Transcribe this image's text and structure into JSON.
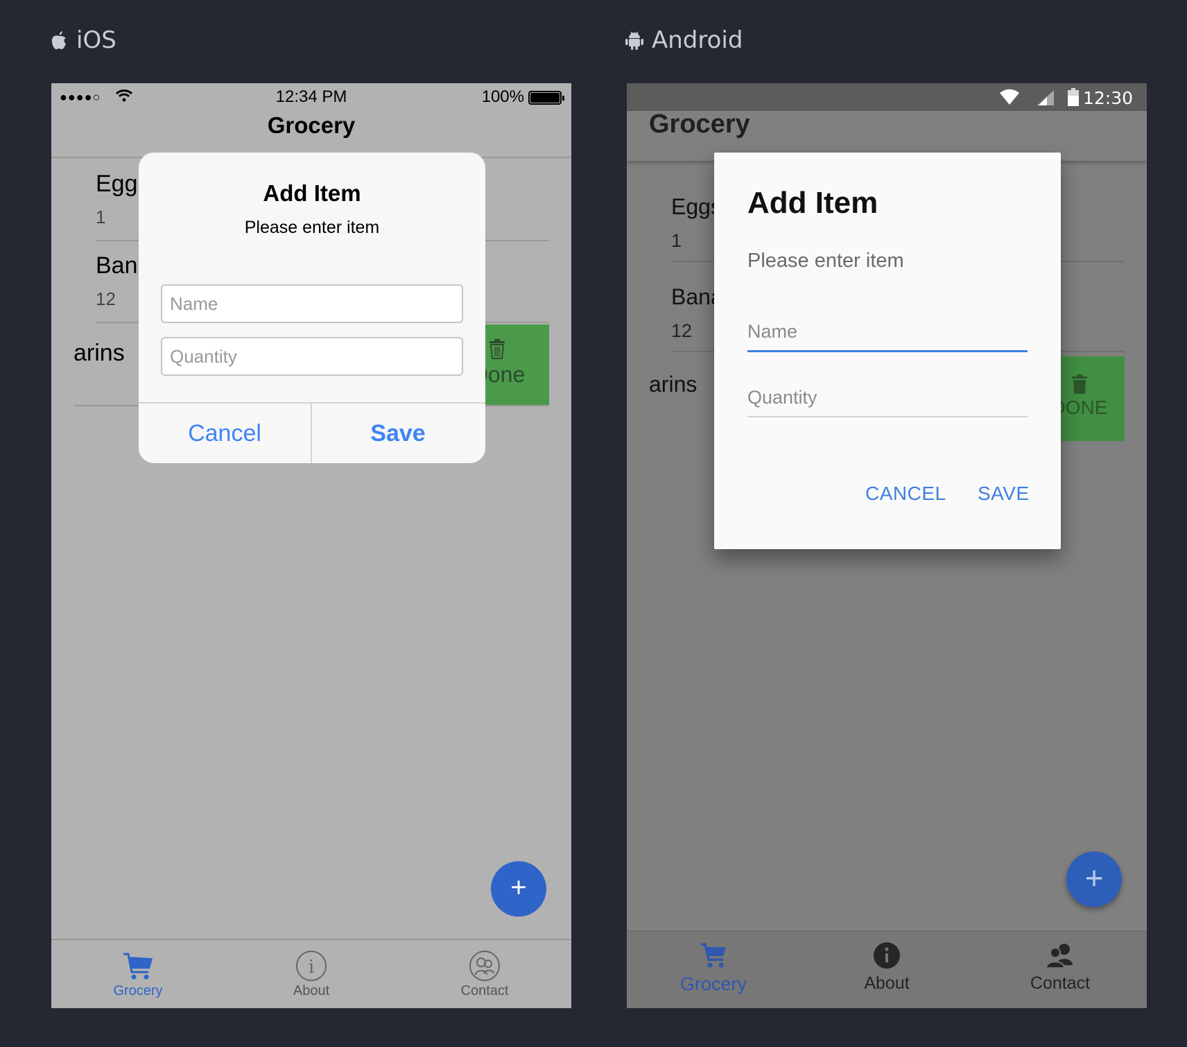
{
  "labels": {
    "ios": "iOS",
    "android": "Android"
  },
  "ios": {
    "status": {
      "signal": "●●●●○",
      "time": "12:34 PM",
      "battery": "100%"
    },
    "nav_title": "Grocery",
    "rows": [
      {
        "name": "Eggs",
        "qty": "1"
      },
      {
        "name": "Bananas",
        "qty": "12"
      }
    ],
    "swiped_row": {
      "name": "arins",
      "action": "Done"
    },
    "fab": "+",
    "tabs": [
      {
        "label": "Grocery",
        "icon": "cart-icon",
        "active": true
      },
      {
        "label": "About",
        "icon": "info-icon",
        "active": false
      },
      {
        "label": "Contact",
        "icon": "contact-icon",
        "active": false
      }
    ],
    "dialog": {
      "title": "Add Item",
      "message": "Please enter item",
      "name_placeholder": "Name",
      "quantity_placeholder": "Quantity",
      "cancel": "Cancel",
      "save": "Save"
    }
  },
  "android": {
    "status": {
      "time": "12:30"
    },
    "app_title": "Grocery",
    "rows": [
      {
        "name": "Eggs",
        "qty": "1"
      },
      {
        "name": "Bananas",
        "qty": "12"
      }
    ],
    "swiped_row": {
      "name": "arins",
      "action": "DONE"
    },
    "fab": "+",
    "tabs": [
      {
        "label": "Grocery",
        "icon": "cart-icon",
        "active": true
      },
      {
        "label": "About",
        "icon": "info-icon",
        "active": false
      },
      {
        "label": "Contact",
        "icon": "contacts-icon",
        "active": false
      }
    ],
    "dialog": {
      "title": "Add Item",
      "message": "Please enter item",
      "name_placeholder": "Name",
      "quantity_placeholder": "Quantity",
      "cancel": "CANCEL",
      "save": "SAVE"
    }
  },
  "colors": {
    "background": "#242832",
    "ios_accent": "#3f85f2",
    "android_accent": "#3f7fe0",
    "fab": "#2f64c8",
    "done_green": "#4a9a4a"
  }
}
